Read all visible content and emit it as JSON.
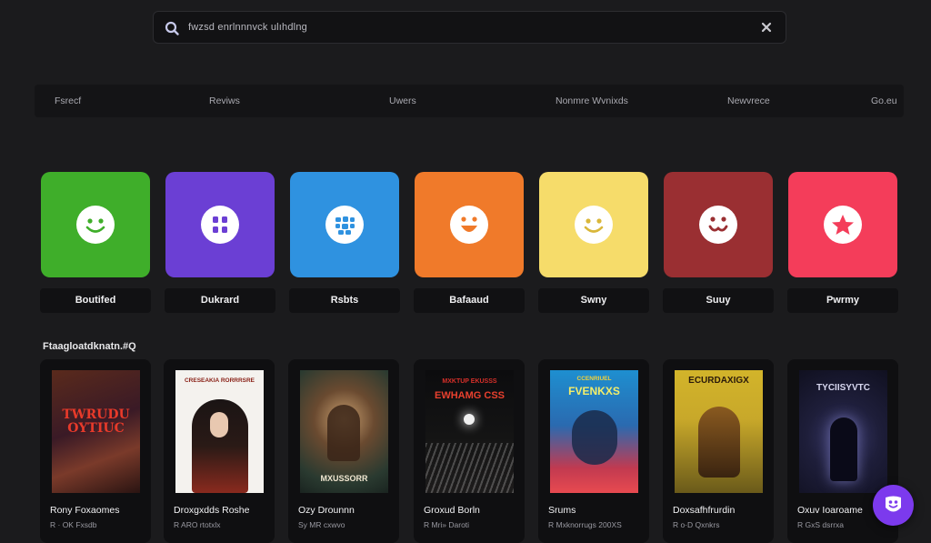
{
  "search": {
    "value": "fwzsd enrlnnnvck ulıhdlng"
  },
  "tabs": [
    "Fsrecf",
    "Reviws",
    "Uwers",
    "Nonmre Wvnixds",
    "Newvrece",
    "Go.eu"
  ],
  "moods": [
    {
      "label": "Boutifed",
      "color": "#3fae2a",
      "icon": "smile-icon"
    },
    {
      "label": "Dukrard",
      "color": "#6b3fd4",
      "icon": "grid-face-icon"
    },
    {
      "label": "Rsbts",
      "color": "#2f92e0",
      "icon": "pattern-face-icon"
    },
    {
      "label": "Bafaaud",
      "color": "#f07a2a",
      "icon": "grin-icon"
    },
    {
      "label": "Swny",
      "color": "#f6dc6a",
      "icon": "smile-icon"
    },
    {
      "label": "Suuy",
      "color": "#9a2f32",
      "icon": "grin-icon"
    },
    {
      "label": "Pwrmy",
      "color": "#f43d5a",
      "icon": "star-icon"
    }
  ],
  "section": {
    "title": "Ftaagloatdknatn.#Q"
  },
  "movies": [
    {
      "title": "Rony Foxaomes",
      "meta": "R · OK Fxsdb",
      "cover": "TWRUDU OYTIUC",
      "cover_top": ""
    },
    {
      "title": "Droxgxdds Roshe",
      "meta": "R ARO rtotxlx",
      "cover": "",
      "cover_top": "CRESEAKIA RORRRSRE"
    },
    {
      "title": "Ozy Drounnn",
      "meta": "Sy MR cxwvo",
      "cover": "MXUSSORR",
      "cover_top": ""
    },
    {
      "title": "Groxud Borln",
      "meta": "R Mri» Daroti",
      "cover": "EWHAMG CSS",
      "cover_top": "MXKTUP EKUSSS"
    },
    {
      "title": "Srums",
      "meta": "R Mxknorrugs 200XS",
      "cover": "FVENKXS",
      "cover_top": "CCENRIUEL"
    },
    {
      "title": "Doxsafhfrurdin",
      "meta": "R o·D Qxnkrs",
      "cover": "ECURDAXIGX",
      "cover_top": ""
    },
    {
      "title": "Oxuv Ioaroame",
      "meta": "R GxS dsrrxa",
      "cover": "TYCIISYVTC",
      "cover_top": ""
    }
  ]
}
